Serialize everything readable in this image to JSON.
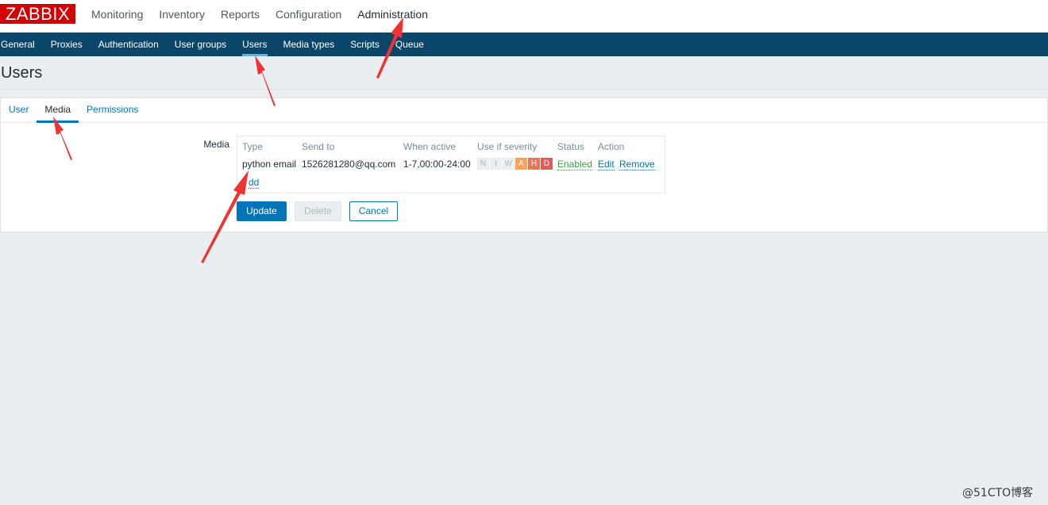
{
  "header": {
    "logo": "ZABBIX",
    "menu": [
      "Monitoring",
      "Inventory",
      "Reports",
      "Configuration",
      "Administration"
    ]
  },
  "subnav": [
    "General",
    "Proxies",
    "Authentication",
    "User groups",
    "Users",
    "Media types",
    "Scripts",
    "Queue"
  ],
  "page_title": "Users",
  "tabs": [
    "User",
    "Media",
    "Permissions"
  ],
  "form": {
    "media_label": "Media",
    "columns": [
      "Type",
      "Send to",
      "When active",
      "Use if severity",
      "Status",
      "Action"
    ],
    "row": {
      "type": "python email",
      "send_to": "1526281280@qq.com",
      "when_active": "1-7,00:00-24:00",
      "severity": [
        "N",
        "I",
        "W",
        "A",
        "H",
        "D"
      ],
      "status": "Enabled",
      "edit": "Edit",
      "remove": "Remove"
    },
    "add_link": "dd"
  },
  "buttons": {
    "update": "Update",
    "delete": "Delete",
    "cancel": "Cancel"
  },
  "watermark": "@51CTO博客",
  "colors": {
    "logo_red": "#d40000",
    "subnav_bg": "#0a466a",
    "link_blue": "#0275b8",
    "status_green": "#429e47",
    "annotation_red": "#ee3333"
  }
}
